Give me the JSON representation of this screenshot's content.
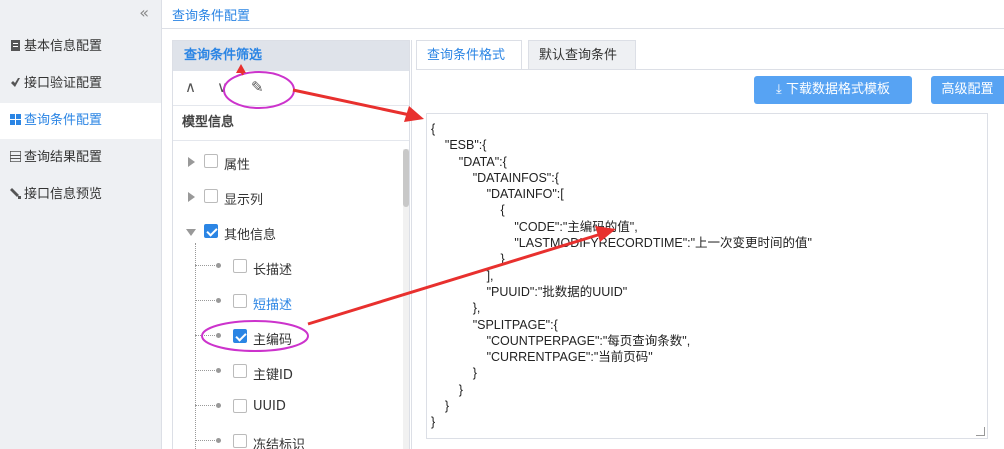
{
  "sidebar": {
    "collapse_icon": "«",
    "items": [
      {
        "label": "基本信息配置",
        "icon": "document-icon",
        "active": false
      },
      {
        "label": "接口验证配置",
        "icon": "check-icon",
        "active": false
      },
      {
        "label": "查询条件配置",
        "icon": "grid-icon",
        "active": true
      },
      {
        "label": "查询结果配置",
        "icon": "table-icon",
        "active": false
      },
      {
        "label": "接口信息预览",
        "icon": "preview-icon",
        "active": false
      }
    ]
  },
  "page": {
    "title": "查询条件配置"
  },
  "filter_panel": {
    "header": "查询条件筛选",
    "toolbar": {
      "up_icon": "∧",
      "down_icon": "∨",
      "edit_icon": "✎"
    },
    "model_title": "模型信息",
    "tree": [
      {
        "label": "属性",
        "checked": false
      },
      {
        "label": "显示列",
        "checked": false
      },
      {
        "label": "其他信息",
        "checked": true
      },
      {
        "label": "长描述",
        "checked": false
      },
      {
        "label": "短描述",
        "checked": false
      },
      {
        "label": "主编码",
        "checked": true
      },
      {
        "label": "主键ID",
        "checked": false
      },
      {
        "label": "UUID",
        "checked": false
      },
      {
        "label": "冻结标识",
        "checked": false
      }
    ]
  },
  "tabs": [
    {
      "label": "查询条件格式",
      "active": true
    },
    {
      "label": "默认查询条件",
      "active": false
    }
  ],
  "buttons": {
    "download": "下载数据格式模板",
    "download_icon": "⤓",
    "advanced": "高级配置"
  },
  "json_editor": {
    "content": "{\n\t\"ESB\":{\n\t\t\"DATA\":{\n\t\t\t\"DATAINFOS\":{\n\t\t\t\t\"DATAINFO\":[\n\t\t\t\t\t{\n\t\t\t\t\t\t\"CODE\":\"主编码的值\",\n\t\t\t\t\t\t\"LASTMODIFYRECORDTIME\":\"上一次变更时间的值\"\n\t\t\t\t\t}\n\t\t\t\t],\n\t\t\t\t\"PUUID\":\"批数据的UUID\"\n\t\t\t},\n\t\t\t\"SPLITPAGE\":{\n\t\t\t\t\"COUNTPERPAGE\":\"每页查询条数\",\n\t\t\t\t\"CURRENTPAGE\":\"当前页码\"\n\t\t\t}\n\t\t}\n\t}\n}"
  },
  "colors": {
    "accent": "#2b85e4",
    "button": "#57a3f3",
    "annotation": "#e8302e",
    "highlight": "#cc33cc"
  }
}
